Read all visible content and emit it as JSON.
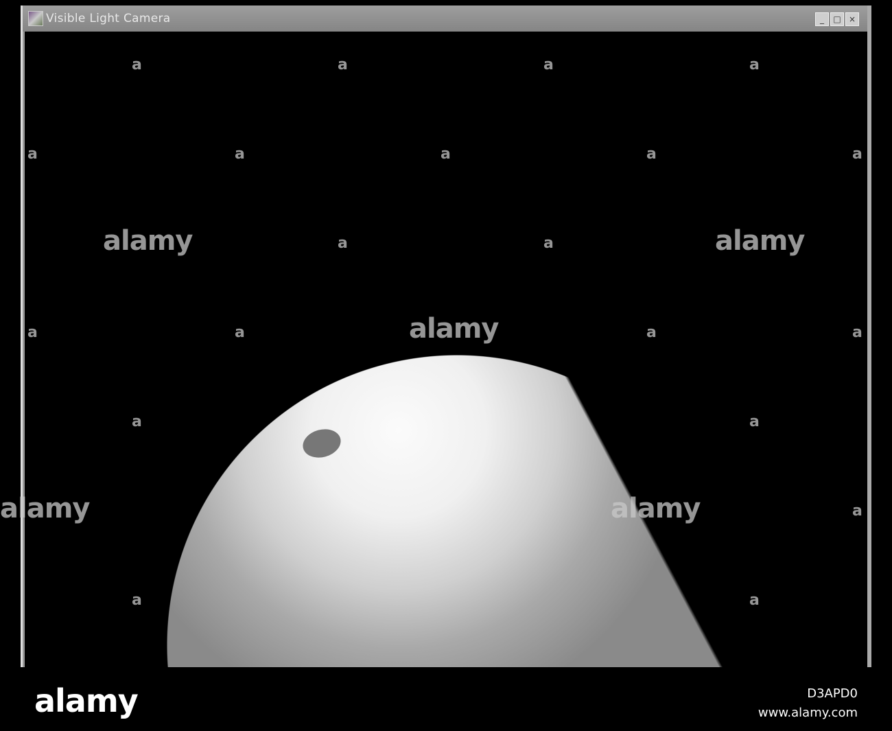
{
  "window": {
    "title": "Visible Light Camera",
    "minimize": "_",
    "maximize": "□",
    "close": "×"
  },
  "watermark": {
    "text": "alamy",
    "small": "a"
  },
  "footer": {
    "logo": "alamy",
    "image_id": "D3APD0",
    "url": "www.alamy.com"
  }
}
